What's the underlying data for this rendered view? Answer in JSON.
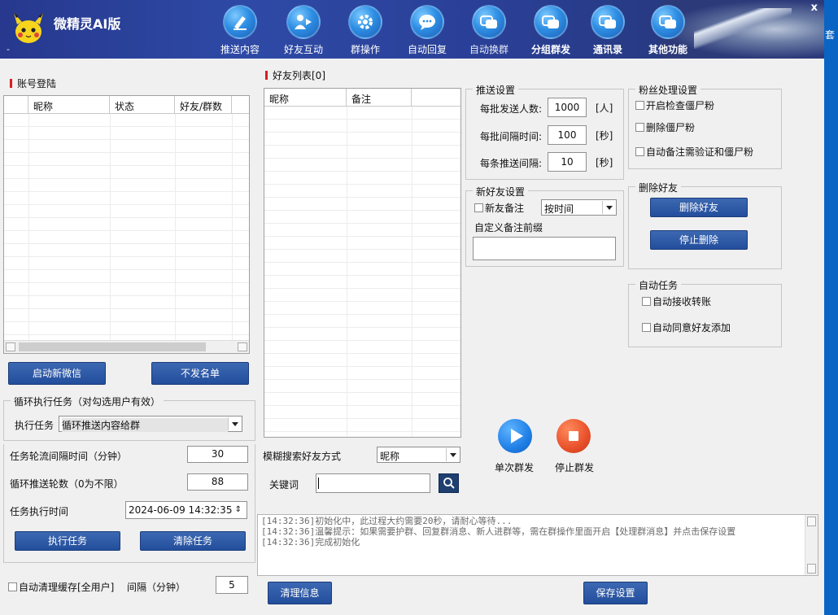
{
  "app": {
    "title": "微精灵AI版",
    "subtitle_dash": "-",
    "close": "x"
  },
  "nav": [
    {
      "label": "推送内容",
      "icon": "pen-icon",
      "style": "normal"
    },
    {
      "label": "好友互动",
      "icon": "user-share-icon",
      "style": "normal"
    },
    {
      "label": "群操作",
      "icon": "gear-icon",
      "style": "normal"
    },
    {
      "label": "自动回复",
      "icon": "chat-bubble-icon",
      "style": "normal"
    },
    {
      "label": "自动换群",
      "icon": "chat-bubbles-icon",
      "style": "dim"
    },
    {
      "label": "分组群发",
      "icon": "chat-bubbles-icon",
      "style": "bold"
    },
    {
      "label": "通讯录",
      "icon": "chat-bubbles-icon",
      "style": "bold"
    },
    {
      "label": "其他功能",
      "icon": "chat-bubbles-icon",
      "style": "bold"
    }
  ],
  "side_text": "套",
  "account": {
    "title": "账号登陆",
    "columns": [
      "昵称",
      "状态",
      "好友/群数"
    ],
    "btn_start": "启动新微信",
    "btn_blacklist": "不发名单"
  },
  "loop_task": {
    "group_title": "循环执行任务（对勾选用户有效）",
    "task_label": "执行任务",
    "task_value": "循环推送内容给群",
    "interval_label": "任务轮流间隔时间（分钟）",
    "interval_value": "30",
    "rounds_label": "循环推送轮数（0为不限）",
    "rounds_value": "88",
    "time_label": "任务执行时间",
    "time_value": "2024-06-09 14:32:35",
    "btn_run": "执行任务",
    "btn_clear": "清除任务",
    "auto_clean_label": "自动清理缓存[全用户]",
    "auto_interval_label": "间隔（分钟）",
    "auto_interval_value": "5"
  },
  "friends": {
    "title": "好友列表[0]",
    "columns": [
      "昵称",
      "备注"
    ],
    "search_mode_label": "模糊搜索好友方式",
    "search_mode_value": "昵称",
    "keyword_label": "关键词",
    "keyword_value": ""
  },
  "push": {
    "group_title": "推送设置",
    "per_batch_label": "每批发送人数:",
    "per_batch_value": "1000",
    "per_batch_unit": "[人]",
    "batch_interval_label": "每批间隔时间:",
    "batch_interval_value": "100",
    "batch_interval_unit": "[秒]",
    "each_interval_label": "每条推送间隔:",
    "each_interval_value": "10",
    "each_interval_unit": "[秒]"
  },
  "new_friend": {
    "group_title": "新好友设置",
    "remark_label": "新友备注",
    "remark_mode": "按时间",
    "prefix_label": "自定义备注前缀",
    "prefix_value": ""
  },
  "fans": {
    "group_title": "粉丝处理设置",
    "opt1": "开启检查僵尸粉",
    "opt2": "删除僵尸粉",
    "opt3": "自动备注需验证和僵尸粉"
  },
  "delete_friends": {
    "group_title": "删除好友",
    "btn_delete": "删除好友",
    "btn_stop": "停止删除"
  },
  "auto_task": {
    "group_title": "自动任务",
    "opt1": "自动接收转账",
    "opt2": "自动同意好友添加"
  },
  "send": {
    "single_label": "单次群发",
    "stop_label": "停止群发",
    "play_color": "#1f7fe6",
    "stop_color": "#e8502a"
  },
  "log": {
    "lines": [
      "[14:32:36]初始化中，此过程大约需要20秒，请耐心等待...",
      "[14:32:36]温馨提示：如果需要护群、回复群消息、新人进群等，需在群操作里面开启【处理群消息】并点击保存设置",
      "[14:32:36]完成初始化"
    ]
  },
  "footer": {
    "btn_clear_info": "清理信息",
    "btn_save": "保存设置"
  }
}
